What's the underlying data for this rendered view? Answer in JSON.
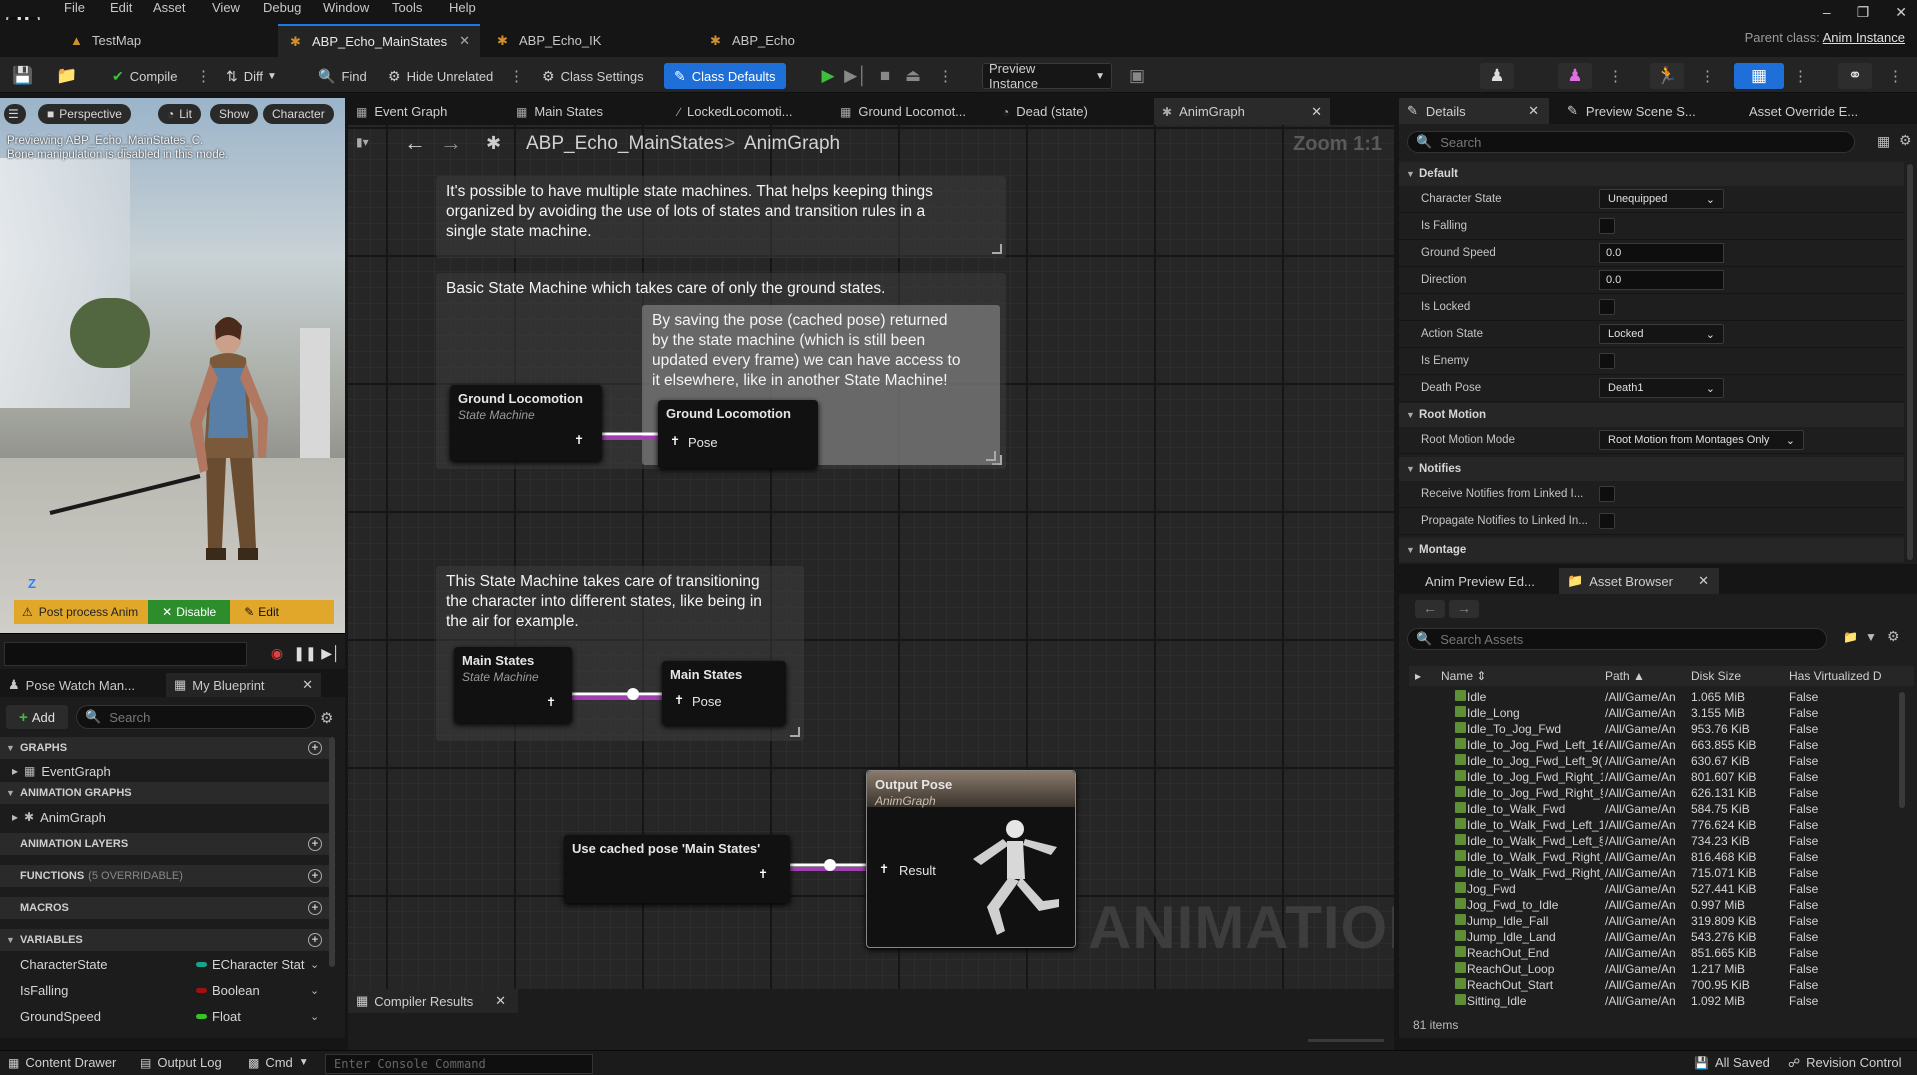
{
  "menu": [
    "File",
    "Edit",
    "Asset",
    "View",
    "Debug",
    "Window",
    "Tools",
    "Help"
  ],
  "doc_tabs": [
    {
      "label": "TestMap",
      "active": false
    },
    {
      "label": "ABP_Echo_MainStates",
      "active": true
    },
    {
      "label": "ABP_Echo_IK",
      "active": false
    },
    {
      "label": "ABP_Echo",
      "active": false
    }
  ],
  "parent_class": {
    "label": "Parent class:",
    "value": "Anim Instance"
  },
  "toolbar": {
    "compile": "Compile",
    "diff": "Diff",
    "find": "Find",
    "hide_unrelated": "Hide Unrelated",
    "class_settings": "Class Settings",
    "class_defaults": "Class Defaults",
    "preview_instance": "Preview Instance"
  },
  "viewport": {
    "perspective": "Perspective",
    "lit": "Lit",
    "show": "Show",
    "character": "Character",
    "info_line1": "Previewing ABP_Echo_MainStates_C.",
    "info_line2": "Bone manipulation is disabled in this mode.",
    "warn": "Post process Anim",
    "disable": "Disable",
    "edit": "Edit",
    "axis": "Z"
  },
  "left_panel": {
    "tabs": [
      "Pose Watch Man...",
      "My Blueprint"
    ],
    "add": "Add",
    "search_placeholder": "Search",
    "sections": {
      "graphs": "GRAPHS",
      "anim_graphs": "ANIMATION GRAPHS",
      "anim_layers": "ANIMATION LAYERS",
      "functions": "FUNCTIONS",
      "functions_sub": "(5 OVERRIDABLE)",
      "macros": "MACROS",
      "variables": "VARIABLES"
    },
    "event_graph": "EventGraph",
    "anim_graph": "AnimGraph",
    "variables": [
      {
        "name": "CharacterState",
        "type": "ECharacter Stat",
        "color": "#17a589"
      },
      {
        "name": "IsFalling",
        "type": "Boolean",
        "color": "#a01010"
      },
      {
        "name": "GroundSpeed",
        "type": "Float",
        "color": "#39c12a"
      }
    ]
  },
  "graph_tabs": [
    "Event Graph",
    "Main States",
    "LockedLocomoti...",
    "Ground Locomot...",
    "Dead (state)",
    "AnimGraph"
  ],
  "breadcrumb": {
    "bp": "ABP_Echo_MainStates",
    "sep": ">",
    "graph": "AnimGraph",
    "zoom": "Zoom 1:1"
  },
  "comments": {
    "c1": [
      "It's possible to have multiple state machines. That helps keeping things",
      "organized by avoiding the use of lots of states and transition rules in a",
      "single state machine."
    ],
    "c2": [
      "Basic State Machine which takes care of only the ground states."
    ],
    "c3": [
      "By saving the pose (cached pose) returned",
      "by the state machine (which is still been",
      "updated every frame) we can have access to",
      "it elsewhere, like in another State Machine!"
    ],
    "c4": [
      "This State Machine takes care of transitioning",
      "the character into different states, like being in",
      "the air for example."
    ]
  },
  "nodes": {
    "ground_sm": {
      "title": "Ground Locomotion",
      "sub": "State Machine"
    },
    "ground_cache": {
      "title": "Ground Locomotion",
      "pin": "Pose"
    },
    "main_sm": {
      "title": "Main States",
      "sub": "State Machine"
    },
    "main_cache": {
      "title": "Main States",
      "pin": "Pose"
    },
    "use_cached": {
      "title": "Use cached pose 'Main States'"
    },
    "output": {
      "title": "Output Pose",
      "sub": "AnimGraph",
      "pin": "Result"
    }
  },
  "watermark": "ANIMATION",
  "compiler_tab": "Compiler Results",
  "details": {
    "tabs": [
      "Details",
      "Preview Scene S...",
      "Asset Override E..."
    ],
    "search_placeholder": "Search",
    "sections": {
      "default": "Default",
      "root_motion": "Root Motion",
      "notifies": "Notifies",
      "montage": "Montage"
    },
    "props": {
      "character_state": {
        "name": "Character State",
        "value": "Unequipped"
      },
      "is_falling": {
        "name": "Is Falling"
      },
      "ground_speed": {
        "name": "Ground Speed",
        "value": "0.0"
      },
      "direction": {
        "name": "Direction",
        "value": "0.0"
      },
      "is_locked": {
        "name": "Is Locked"
      },
      "action_state": {
        "name": "Action State",
        "value": "Locked"
      },
      "is_enemy": {
        "name": "Is Enemy"
      },
      "death_pose": {
        "name": "Death Pose",
        "value": "Death1"
      },
      "root_motion_mode": {
        "name": "Root Motion Mode",
        "value": "Root Motion from Montages Only"
      },
      "receive_notifies": {
        "name": "Receive Notifies from Linked I..."
      },
      "propagate_notifies": {
        "name": "Propagate Notifies to Linked In..."
      }
    }
  },
  "asset_browser": {
    "tabs": [
      "Anim Preview Ed...",
      "Asset Browser"
    ],
    "search_placeholder": "Search Assets",
    "columns": [
      "Name",
      "Path",
      "Disk Size",
      "Has Virtualized D"
    ],
    "rows": [
      [
        "Idle",
        "/All/Game/An",
        "1.065 MiB",
        "False"
      ],
      [
        "Idle_Long",
        "/All/Game/An",
        "3.155 MiB",
        "False"
      ],
      [
        "Idle_To_Jog_Fwd",
        "/All/Game/An",
        "953.76 KiB",
        "False"
      ],
      [
        "Idle_to_Jog_Fwd_Left_1€",
        "/All/Game/An",
        "663.855 KiB",
        "False"
      ],
      [
        "Idle_to_Jog_Fwd_Left_9(",
        "/All/Game/An",
        "630.67 KiB",
        "False"
      ],
      [
        "Idle_to_Jog_Fwd_Right_1",
        "/All/Game/An",
        "801.607 KiB",
        "False"
      ],
      [
        "Idle_to_Jog_Fwd_Right_§",
        "/All/Game/An",
        "626.131 KiB",
        "False"
      ],
      [
        "Idle_to_Walk_Fwd",
        "/All/Game/An",
        "584.75 KiB",
        "False"
      ],
      [
        "Idle_to_Walk_Fwd_Left_1",
        "/All/Game/An",
        "776.624 KiB",
        "False"
      ],
      [
        "Idle_to_Walk_Fwd_Left_§",
        "/All/Game/An",
        "734.23 KiB",
        "False"
      ],
      [
        "Idle_to_Walk_Fwd_Right_",
        "/All/Game/An",
        "816.468 KiB",
        "False"
      ],
      [
        "Idle_to_Walk_Fwd_Right_",
        "/All/Game/An",
        "715.071 KiB",
        "False"
      ],
      [
        "Jog_Fwd",
        "/All/Game/An",
        "527.441 KiB",
        "False"
      ],
      [
        "Jog_Fwd_to_Idle",
        "/All/Game/An",
        "0.997 MiB",
        "False"
      ],
      [
        "Jump_Idle_Fall",
        "/All/Game/An",
        "319.809 KiB",
        "False"
      ],
      [
        "Jump_Idle_Land",
        "/All/Game/An",
        "543.276 KiB",
        "False"
      ],
      [
        "ReachOut_End",
        "/All/Game/An",
        "851.665 KiB",
        "False"
      ],
      [
        "ReachOut_Loop",
        "/All/Game/An",
        "1.217 MiB",
        "False"
      ],
      [
        "ReachOut_Start",
        "/All/Game/An",
        "700.95 KiB",
        "False"
      ],
      [
        "Sitting_Idle",
        "/All/Game/An",
        "1.092 MiB",
        "False"
      ]
    ],
    "count": "81 items"
  },
  "statusbar": {
    "content_drawer": "Content Drawer",
    "output_log": "Output Log",
    "cmd": "Cmd",
    "console_placeholder": "Enter Console Command",
    "saved": "All Saved",
    "revision": "Revision Control"
  }
}
